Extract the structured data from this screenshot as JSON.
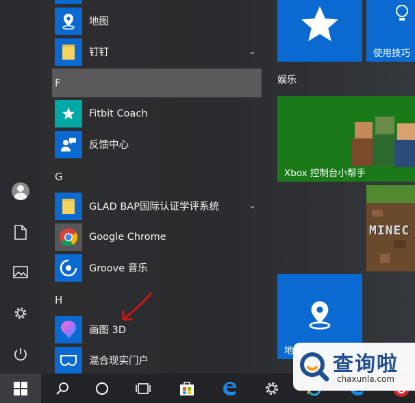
{
  "app_list": {
    "items_top": [
      {
        "label": "地图",
        "icon": "map-pin-icon"
      },
      {
        "label": "钉钉",
        "icon": "folder-icon",
        "expandable": true
      }
    ],
    "sections": [
      {
        "letter": "F",
        "items": [
          {
            "label": "Fitbit Coach",
            "icon": "star-icon"
          },
          {
            "label": "反馈中心",
            "icon": "feedback-person-icon"
          }
        ]
      },
      {
        "letter": "G",
        "items": [
          {
            "label": "GLAD BAP国际认证学评系统",
            "icon": "folder-icon",
            "expandable": true
          },
          {
            "label": "Google Chrome",
            "icon": "chrome-icon"
          },
          {
            "label": "Groove 音乐",
            "icon": "groove-music-icon"
          }
        ]
      },
      {
        "letter": "H",
        "items": [
          {
            "label": "画图 3D",
            "icon": "paint-3d-icon"
          },
          {
            "label": "混合现实门户",
            "icon": "mixed-reality-icon"
          }
        ]
      }
    ]
  },
  "tiles": {
    "tips_label": "使用技巧",
    "group_entertainment": "娱乐",
    "xbox_label": "Xbox 控制台小帮手",
    "minecraft_text": "MINEC",
    "maps_label": "地图"
  },
  "watermark": {
    "title": "查询啦",
    "subtitle": "chaxunla.com"
  },
  "colors": {
    "accent_blue": "#0a6ad1",
    "xbox_green": "#1a7a1a",
    "annotation_red": "#d21414"
  }
}
